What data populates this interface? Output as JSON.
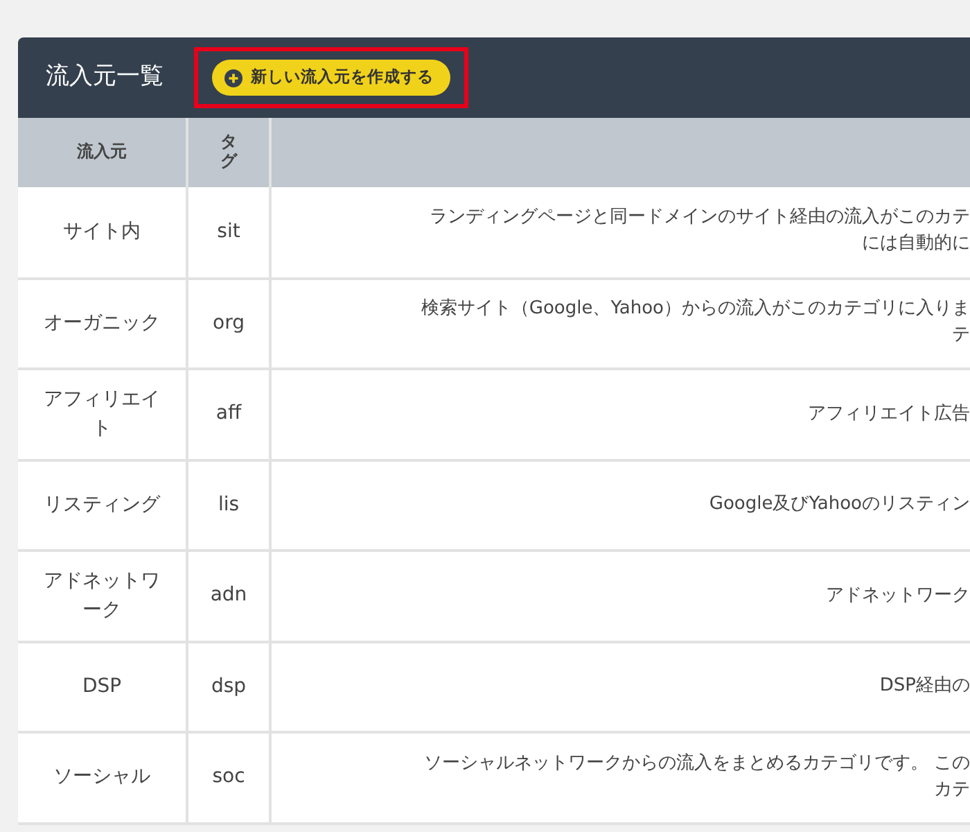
{
  "panel": {
    "title": "流入元一覧",
    "create_button": {
      "label": "新しい流入元を作成する",
      "highlighted": true
    }
  },
  "table": {
    "columns": [
      "流入元",
      "タグ"
    ],
    "rows": [
      {
        "name": "サイト内",
        "tag": "sit",
        "description": [
          "ランディングページと同ードメインのサイト経由の流入がこのカテ",
          "には自動的に"
        ]
      },
      {
        "name": "オーガニック",
        "tag": "org",
        "description": [
          "検索サイト（Google、Yahoo）からの流入がこのカテゴリに入りま",
          "テ"
        ]
      },
      {
        "name": "アフィリエイト",
        "tag": "aff",
        "description": [
          "アフィリエイト広告"
        ]
      },
      {
        "name": "リスティング",
        "tag": "lis",
        "description": [
          "Google及びYahooのリスティン"
        ]
      },
      {
        "name": "アドネットワーク",
        "tag": "adn",
        "description": [
          "アドネットワーク"
        ]
      },
      {
        "name": "DSP",
        "tag": "dsp",
        "description": [
          "DSP経由の"
        ]
      },
      {
        "name": "ソーシャル",
        "tag": "soc",
        "description": [
          "ソーシャルネットワークからの流入をまとめるカテゴリです。 この",
          "カテ"
        ]
      }
    ]
  }
}
